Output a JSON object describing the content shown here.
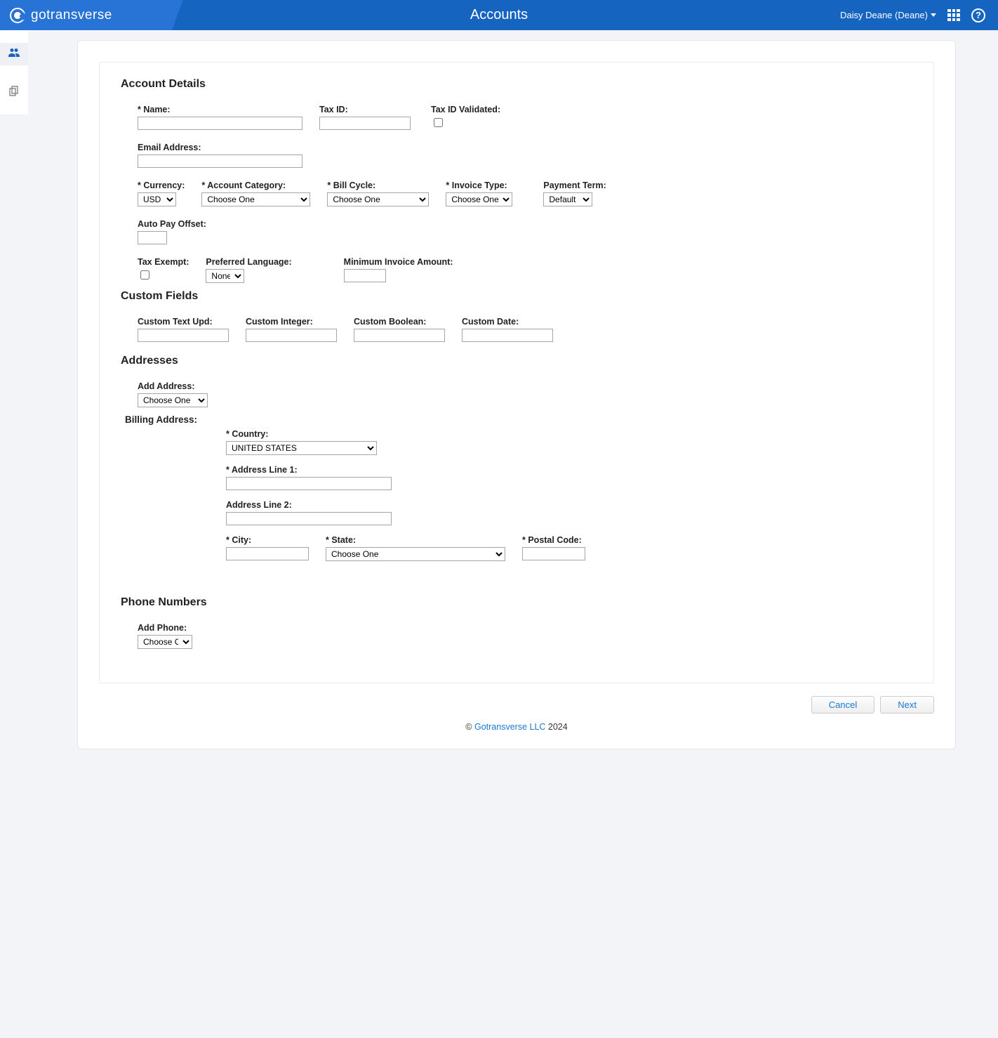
{
  "header": {
    "brand": "gotransverse",
    "title": "Accounts",
    "user": "Daisy Deane (Deane)"
  },
  "sections": {
    "account_details": "Account Details",
    "custom_fields": "Custom Fields",
    "addresses": "Addresses",
    "phone_numbers": "Phone Numbers",
    "billing_address": "Billing Address:"
  },
  "labels": {
    "name": "Name:",
    "tax_id": "Tax ID:",
    "tax_id_validated": "Tax ID Validated:",
    "email": "Email Address:",
    "currency": "Currency:",
    "account_category": "Account Category:",
    "bill_cycle": "Bill Cycle:",
    "invoice_type": "Invoice Type:",
    "payment_term": "Payment Term:",
    "auto_pay_offset": "Auto Pay Offset:",
    "tax_exempt": "Tax Exempt:",
    "preferred_language": "Preferred Language:",
    "min_invoice_amount": "Minimum Invoice Amount:",
    "custom_text_upd": "Custom Text Upd:",
    "custom_integer": "Custom Integer:",
    "custom_boolean": "Custom Boolean:",
    "custom_date": "Custom Date:",
    "add_address": "Add Address:",
    "country": "Country:",
    "address_line_1": "Address Line 1:",
    "address_line_2": "Address Line 2:",
    "city": "City:",
    "state": "State:",
    "postal_code": "Postal Code:",
    "add_phone": "Add Phone:"
  },
  "values": {
    "currency": "USD",
    "account_category": "Choose One",
    "bill_cycle": "Choose One",
    "invoice_type": "Choose One",
    "payment_term": "Default",
    "preferred_language": "None",
    "add_address": "Choose One",
    "country": "UNITED STATES",
    "state": "Choose One",
    "add_phone": "Choose One"
  },
  "buttons": {
    "cancel": "Cancel",
    "next": "Next"
  },
  "footer": {
    "copyright": "© ",
    "link": "Gotransverse LLC",
    "year": " 2024"
  }
}
